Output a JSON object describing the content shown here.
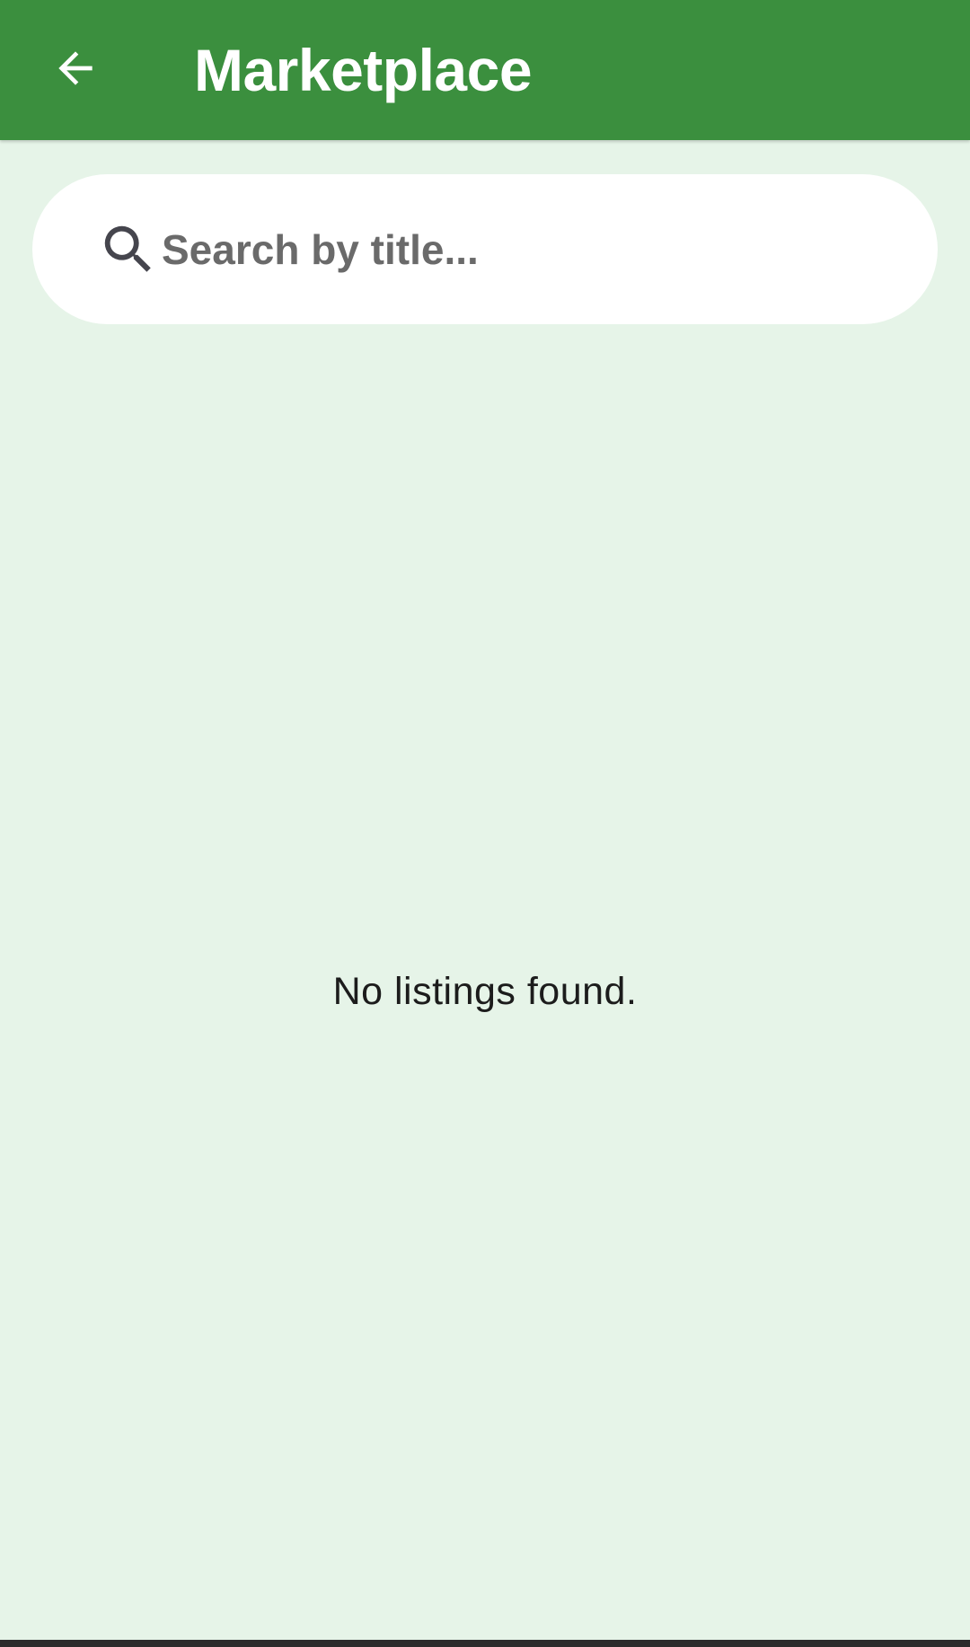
{
  "header": {
    "title": "Marketplace",
    "back_icon": "arrow-back-icon",
    "background_color": "#3b8f3e"
  },
  "search": {
    "placeholder": "Search by title...",
    "value": "",
    "icon": "search-icon"
  },
  "content": {
    "empty_message": "No listings found."
  },
  "colors": {
    "accent": "#3b8f3e",
    "background": "#e6f4e8",
    "surface": "#ffffff"
  }
}
